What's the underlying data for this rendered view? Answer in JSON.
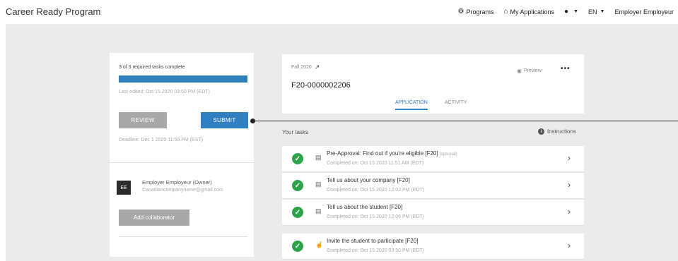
{
  "header": {
    "brand": "Career Ready Program",
    "nav": {
      "programs": "Programs",
      "my_applications": "My Applications",
      "language": "EN",
      "user": "Employer Employeur"
    }
  },
  "left_panel": {
    "tasks_complete": "3 of 3 required tasks complete",
    "progress_percent": 100,
    "last_edited": "Last edited: Oct 15 2020 03:50 PM (EDT)",
    "review_label": "REVIEW",
    "submit_label": "SUBMIT",
    "deadline": "Deadline: Dec 1 2020 11:59 PM (EST)",
    "owner": {
      "initials": "EE",
      "name": "Employer Employeur (Owner)",
      "email": "Canadiancompanyname@gmail.com"
    },
    "add_collaborator_label": "Add collaborator"
  },
  "application": {
    "term": "Fall 2020",
    "id": "F20-0000002206",
    "preview_label": "Preview",
    "kebab": "•••",
    "tabs": [
      "APPLICATION",
      "ACTIVITY"
    ]
  },
  "tasks_section": {
    "heading": "Your tasks",
    "instructions_label": "Instructions"
  },
  "tasks": [
    {
      "title": "Pre-Approval: Find out if you're eligible [F20]",
      "optional": "(optional)",
      "completed": "Completed on: Oct 15 2020 11:51 AM (EDT)",
      "icon": "document-icon"
    },
    {
      "title": "Tell us about your company [F20]",
      "optional": "",
      "completed": "Completed on: Oct 15 2020 12:02 PM (EDT)",
      "icon": "document-icon"
    },
    {
      "title": "Tell us about the student [F20]",
      "optional": "",
      "completed": "Completed on: Oct 15 2020 12:06 PM (EDT)",
      "icon": "document-icon"
    },
    {
      "title": "Invite the student to participate [F20]",
      "optional": "",
      "completed": "Completed on: Oct 15 2020 03:50 PM (EDT)",
      "icon": "thumbs-up-icon"
    }
  ],
  "colors": {
    "primary": "#2f7fc1",
    "success": "#2ca34a",
    "disabled": "#a8a8a8",
    "canvas": "#ebebeb"
  }
}
